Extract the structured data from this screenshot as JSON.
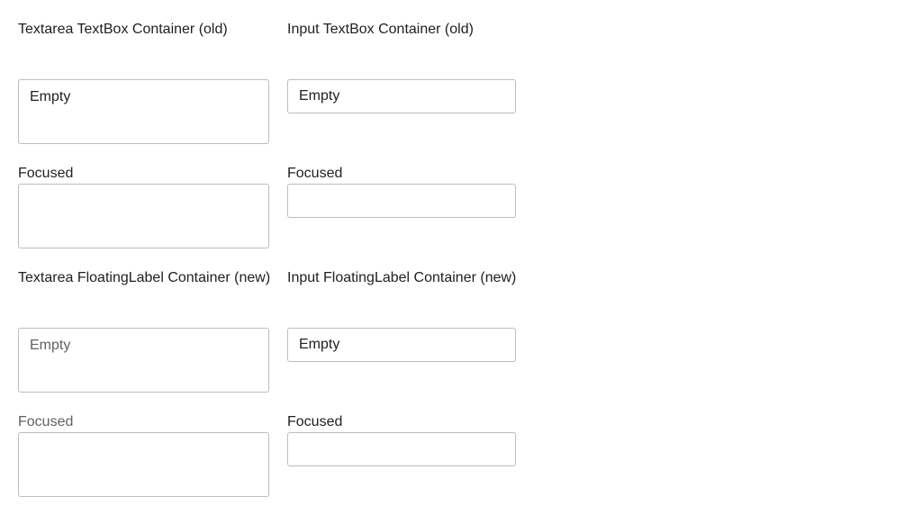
{
  "old": {
    "textarea_heading": "Textarea TextBox Container (old)",
    "input_heading": "Input TextBox Container (old)",
    "textarea_empty_text": "Empty",
    "input_empty_text": "Empty",
    "textarea_focused_label": "Focused",
    "input_focused_label": "Focused"
  },
  "new": {
    "textarea_heading": "Textarea FloatingLabel Container (new)",
    "input_heading": "Input FloatingLabel Container (new)",
    "textarea_empty_text": "Empty",
    "input_empty_text": "Empty",
    "textarea_focused_label": "Focused",
    "input_focused_label": "Focused"
  },
  "colors": {
    "text": "#212121",
    "muted_text": "#616161",
    "border": "#bdbdbd"
  }
}
